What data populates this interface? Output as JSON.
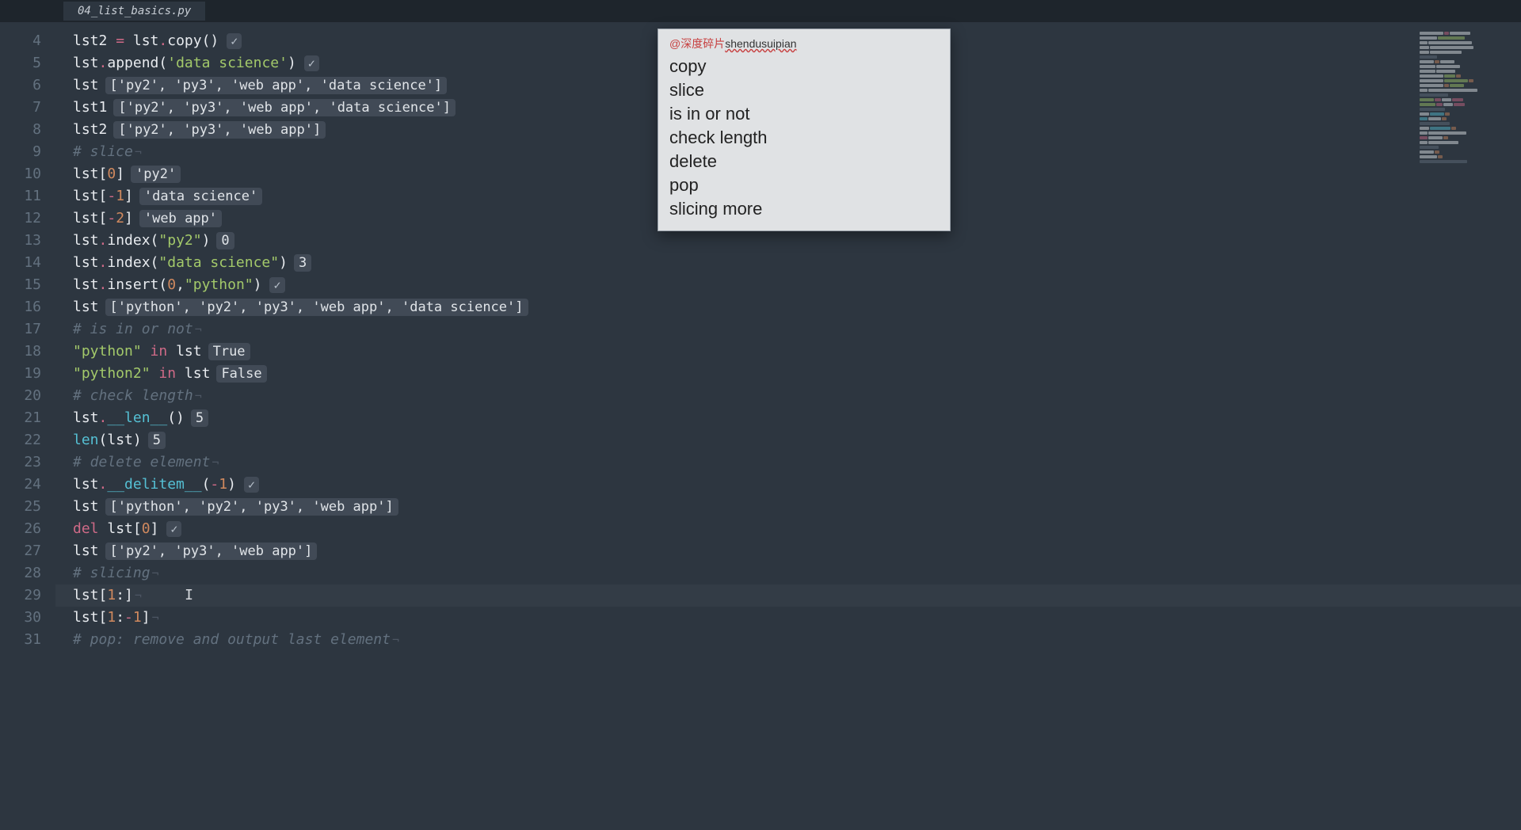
{
  "tab": {
    "filename": "04_list_basics.py"
  },
  "line_start": 4,
  "lines": [
    {
      "n": 4,
      "segs": [
        [
          "c-var",
          "lst2 "
        ],
        [
          "c-op",
          "="
        ],
        [
          "c-var",
          " lst"
        ],
        [
          "c-op",
          "."
        ],
        [
          "c-fn",
          "copy"
        ],
        [
          "c-var",
          "()"
        ]
      ],
      "check": true
    },
    {
      "n": 5,
      "segs": [
        [
          "c-var",
          "lst"
        ],
        [
          "c-op",
          "."
        ],
        [
          "c-fn",
          "append"
        ],
        [
          "c-var",
          "("
        ],
        [
          "c-str",
          "'data science'"
        ],
        [
          "c-var",
          ")"
        ]
      ],
      "check": true
    },
    {
      "n": 6,
      "segs": [
        [
          "c-var",
          "lst"
        ]
      ],
      "badge": "['py2', 'py3', 'web app', 'data science']"
    },
    {
      "n": 7,
      "segs": [
        [
          "c-var",
          "lst1"
        ]
      ],
      "badge": "['py2', 'py3', 'web app', 'data science']"
    },
    {
      "n": 8,
      "segs": [
        [
          "c-var",
          "lst2"
        ]
      ],
      "badge": "['py2', 'py3', 'web app']"
    },
    {
      "n": 9,
      "segs": [
        [
          "c-cmt",
          "# slice"
        ]
      ],
      "eol": true
    },
    {
      "n": 10,
      "segs": [
        [
          "c-var",
          "lst["
        ],
        [
          "c-num",
          "0"
        ],
        [
          "c-var",
          "]"
        ]
      ],
      "badge": "'py2'"
    },
    {
      "n": 11,
      "segs": [
        [
          "c-var",
          "lst["
        ],
        [
          "c-op",
          "-"
        ],
        [
          "c-num",
          "1"
        ],
        [
          "c-var",
          "]"
        ]
      ],
      "badge": "'data science'"
    },
    {
      "n": 12,
      "segs": [
        [
          "c-var",
          "lst["
        ],
        [
          "c-op",
          "-"
        ],
        [
          "c-num",
          "2"
        ],
        [
          "c-var",
          "]"
        ]
      ],
      "badge": "'web app'"
    },
    {
      "n": 13,
      "segs": [
        [
          "c-var",
          "lst"
        ],
        [
          "c-op",
          "."
        ],
        [
          "c-fn",
          "index"
        ],
        [
          "c-var",
          "("
        ],
        [
          "c-str",
          "\"py2\""
        ],
        [
          "c-var",
          ")"
        ]
      ],
      "badge": "0"
    },
    {
      "n": 14,
      "segs": [
        [
          "c-var",
          "lst"
        ],
        [
          "c-op",
          "."
        ],
        [
          "c-fn",
          "index"
        ],
        [
          "c-var",
          "("
        ],
        [
          "c-str",
          "\"data science\""
        ],
        [
          "c-var",
          ")"
        ]
      ],
      "badge": "3"
    },
    {
      "n": 15,
      "segs": [
        [
          "c-var",
          "lst"
        ],
        [
          "c-op",
          "."
        ],
        [
          "c-fn",
          "insert"
        ],
        [
          "c-var",
          "("
        ],
        [
          "c-num",
          "0"
        ],
        [
          "c-var",
          ","
        ],
        [
          "c-str",
          "\"python\""
        ],
        [
          "c-var",
          ")"
        ]
      ],
      "check": true
    },
    {
      "n": 16,
      "segs": [
        [
          "c-var",
          "lst"
        ]
      ],
      "badge": "['python', 'py2', 'py3', 'web app', 'data science']"
    },
    {
      "n": 17,
      "segs": [
        [
          "c-cmt",
          "# is in or not"
        ]
      ],
      "eol": true
    },
    {
      "n": 18,
      "segs": [
        [
          "c-str",
          "\"python\""
        ],
        [
          "c-var",
          " "
        ],
        [
          "c-kw",
          "in"
        ],
        [
          "c-var",
          " lst"
        ]
      ],
      "badge": "True"
    },
    {
      "n": 19,
      "segs": [
        [
          "c-str",
          "\"python2\""
        ],
        [
          "c-var",
          " "
        ],
        [
          "c-kw",
          "in"
        ],
        [
          "c-var",
          " lst"
        ]
      ],
      "badge": "False"
    },
    {
      "n": 20,
      "segs": [
        [
          "c-cmt",
          "# check length"
        ]
      ],
      "eol": true
    },
    {
      "n": 21,
      "segs": [
        [
          "c-var",
          "lst"
        ],
        [
          "c-op",
          "."
        ],
        [
          "c-mag",
          "__len__"
        ],
        [
          "c-var",
          "()"
        ]
      ],
      "badge": "5"
    },
    {
      "n": 22,
      "segs": [
        [
          "c-mag",
          "len"
        ],
        [
          "c-var",
          "(lst)"
        ]
      ],
      "badge": "5"
    },
    {
      "n": 23,
      "segs": [
        [
          "c-cmt",
          "# delete element"
        ]
      ],
      "eol": true
    },
    {
      "n": 24,
      "segs": [
        [
          "c-var",
          "lst"
        ],
        [
          "c-op",
          "."
        ],
        [
          "c-mag",
          "__delitem__"
        ],
        [
          "c-var",
          "("
        ],
        [
          "c-op",
          "-"
        ],
        [
          "c-num",
          "1"
        ],
        [
          "c-var",
          ")"
        ]
      ],
      "check": true
    },
    {
      "n": 25,
      "segs": [
        [
          "c-var",
          "lst"
        ]
      ],
      "badge": "['python', 'py2', 'py3', 'web app']"
    },
    {
      "n": 26,
      "segs": [
        [
          "c-del",
          "del"
        ],
        [
          "c-var",
          " lst["
        ],
        [
          "c-num",
          "0"
        ],
        [
          "c-var",
          "]"
        ]
      ],
      "check": true
    },
    {
      "n": 27,
      "segs": [
        [
          "c-var",
          "lst"
        ]
      ],
      "badge": "['py2', 'py3', 'web app']"
    },
    {
      "n": 28,
      "segs": [
        [
          "c-cmt",
          "# slicing"
        ]
      ],
      "eol": true
    },
    {
      "n": 29,
      "segs": [
        [
          "c-var",
          "lst["
        ],
        [
          "c-num",
          "1"
        ],
        [
          "c-var",
          ":]"
        ]
      ],
      "eol": true,
      "cursor": true,
      "current": true
    },
    {
      "n": 30,
      "segs": [
        [
          "c-var",
          "lst["
        ],
        [
          "c-num",
          "1"
        ],
        [
          "c-var",
          ":"
        ],
        [
          "c-op",
          "-"
        ],
        [
          "c-num",
          "1"
        ],
        [
          "c-var",
          "]"
        ]
      ],
      "eol": true
    },
    {
      "n": 31,
      "segs": [
        [
          "c-cmt",
          "# pop: remove and output last element"
        ]
      ],
      "eol": true
    }
  ],
  "popup": {
    "head_prefix": "@深度碎片",
    "head_sub": "shendusuipian",
    "items": [
      "copy",
      "slice",
      "is in or not",
      "check length",
      "delete",
      "pop",
      "slicing more"
    ]
  }
}
